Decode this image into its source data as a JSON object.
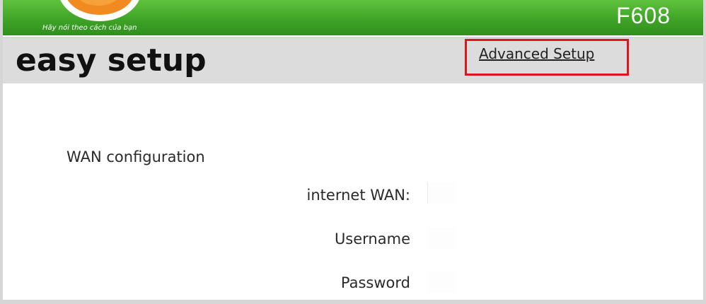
{
  "banner": {
    "slogan": "Hãy nói theo cách của bạn",
    "model": "F608"
  },
  "header": {
    "title": "easy setup",
    "advanced_link": "Advanced Setup"
  },
  "form": {
    "section_title": "WAN configuration",
    "fields": [
      {
        "label": "internet WAN:",
        "value": ""
      },
      {
        "label": "Username",
        "value": ""
      },
      {
        "label": "Password",
        "value": ""
      }
    ]
  },
  "colors": {
    "banner_green": "#3fa427",
    "logo_orange": "#f08a21",
    "highlight_red": "#e0141b"
  }
}
